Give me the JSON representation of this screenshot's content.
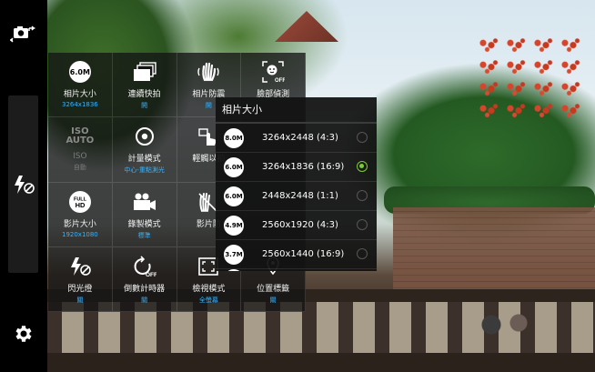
{
  "quick_settings": {
    "cells": [
      {
        "label": "相片大小",
        "value": "3264x1836",
        "icon": "6.0M"
      },
      {
        "label": "連續快拍",
        "value": "開",
        "icon": "burst-icon"
      },
      {
        "label": "相片防震",
        "value": "開",
        "icon": "anti-shake-icon"
      },
      {
        "label": "臉部偵測",
        "value": "",
        "icon": "face-detection-off-icon"
      },
      {
        "label": "ISO",
        "value": "自動",
        "icon": "iso-auto-icon"
      },
      {
        "label": "計量模式",
        "value": "中心-重點測光",
        "icon": "metering-icon"
      },
      {
        "label": "輕觸以拍",
        "value": "",
        "icon": "tap-to-shoot-icon"
      },
      {
        "label": "",
        "value": "",
        "icon": ""
      },
      {
        "label": "影片大小",
        "value": "1920x1080",
        "icon": "full-hd-icon"
      },
      {
        "label": "錄製模式",
        "value": "標準",
        "icon": "video-camera-icon"
      },
      {
        "label": "影片防",
        "value": "",
        "icon": "video-stabilization-icon"
      },
      {
        "label": "",
        "value": "",
        "icon": ""
      },
      {
        "label": "閃光燈",
        "value": "關",
        "icon": "flash-off-icon"
      },
      {
        "label": "倒數計時器",
        "value": "關",
        "icon": "timer-off-icon"
      },
      {
        "label": "檢視模式",
        "value": "全螢幕",
        "icon": "view-mode-icon"
      },
      {
        "label": "位置標籤",
        "value": "關",
        "icon": "location-tag-icon"
      }
    ]
  },
  "popup": {
    "title": "相片大小",
    "options": [
      {
        "badge": "8.0M",
        "text": "3264x2448 (4:3)",
        "selected": false
      },
      {
        "badge": "6.0M",
        "text": "3264x1836 (16:9)",
        "selected": true
      },
      {
        "badge": "6.0M",
        "text": "2448x2448 (1:1)",
        "selected": false
      },
      {
        "badge": "4.9M",
        "text": "2560x1920 (4:3)",
        "selected": false
      },
      {
        "badge": "3.7M",
        "text": "2560x1440 (16:9)",
        "selected": false
      }
    ]
  },
  "left_bar": {
    "icons": [
      "switch-camera-icon",
      "flash-off-icon",
      "settings-gear-icon"
    ]
  },
  "colors": {
    "accent_value": "#36b3ff",
    "radio_selected": "#7bcc2e",
    "panel_bg": "#141414"
  },
  "watermark": ""
}
